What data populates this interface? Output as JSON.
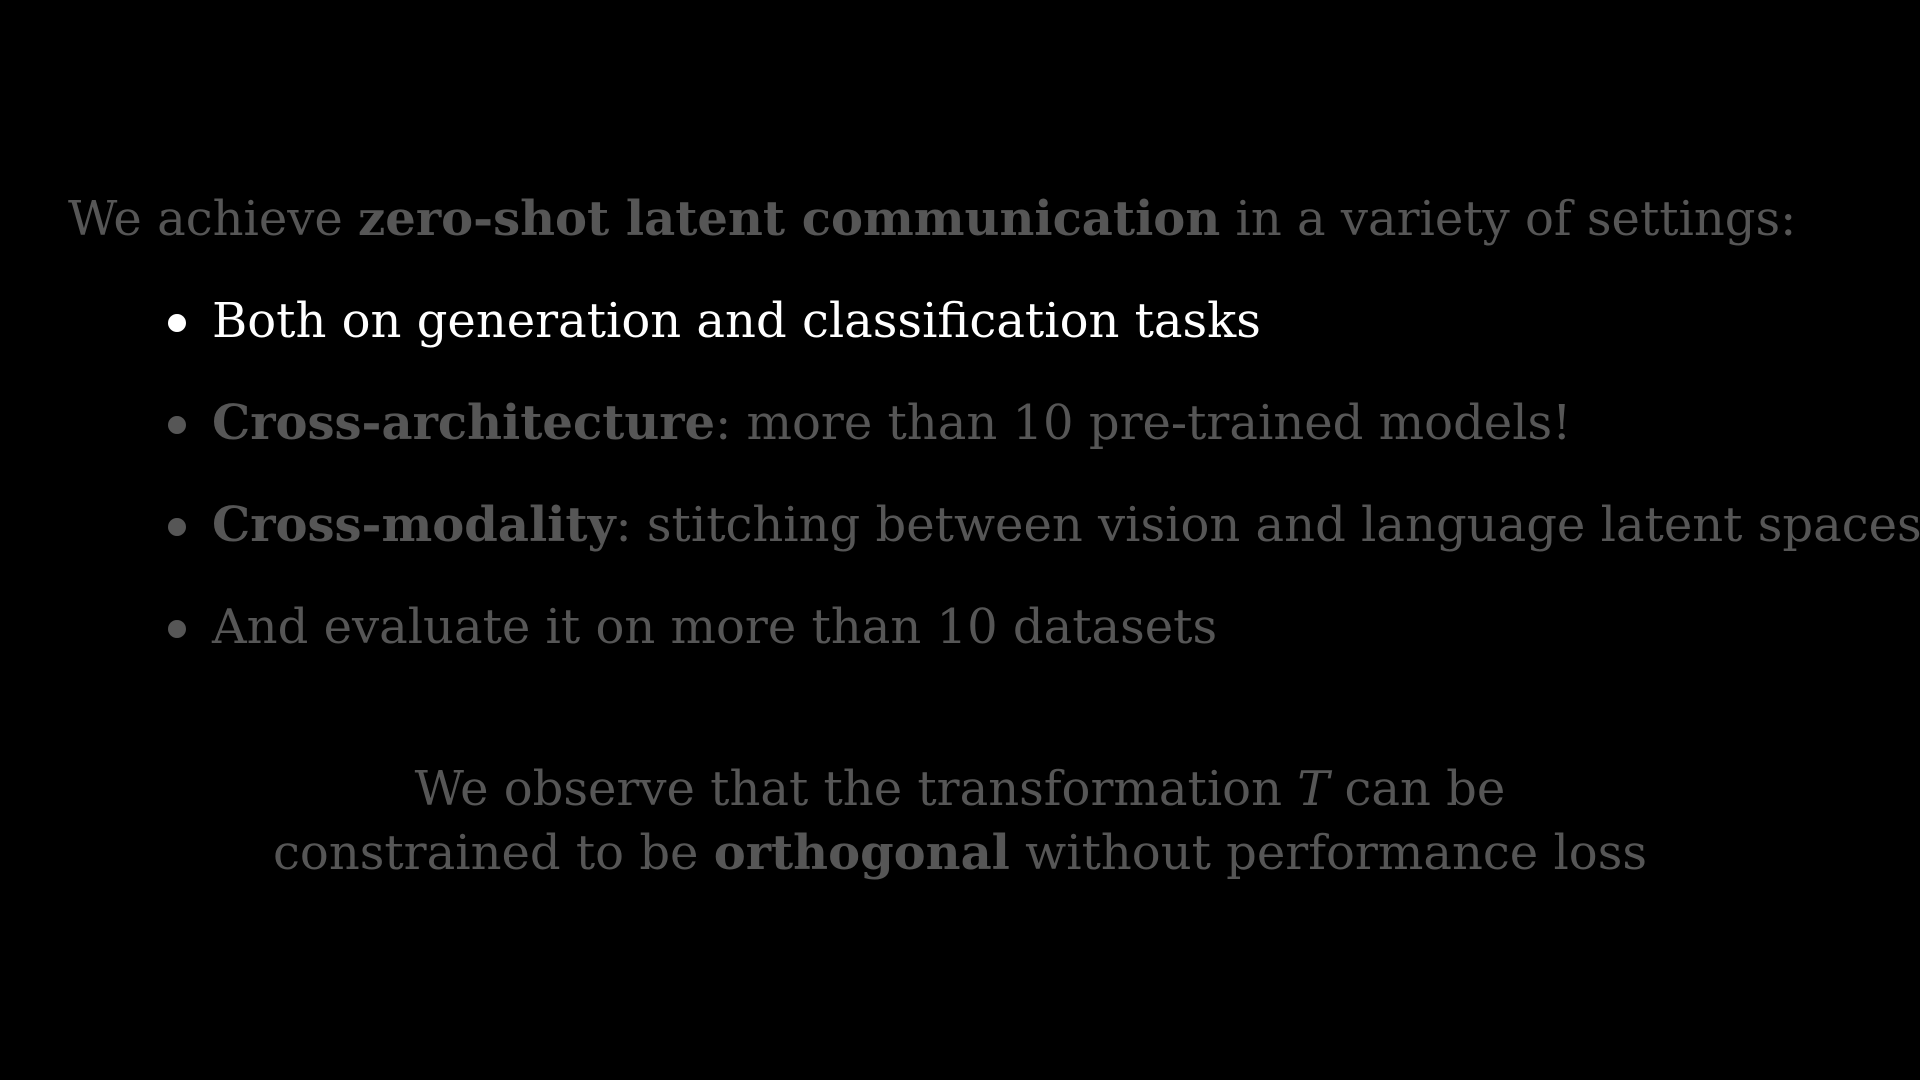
{
  "colors": {
    "background": "#000000",
    "dim": "#565656",
    "highlight": "#ffffff"
  },
  "intro": {
    "prefix": "We achieve ",
    "bold": "zero-shot latent communication",
    "suffix": " in a variety of settings:"
  },
  "bullets": [
    {
      "bold": "",
      "text": "Both on generation and classification tasks",
      "highlighted": true
    },
    {
      "bold": "Cross-architecture",
      "text": ": more than 10 pre-trained models!",
      "highlighted": false
    },
    {
      "bold": "Cross-modality",
      "text": ": stitching between vision and language latent spaces",
      "highlighted": false
    },
    {
      "bold": "",
      "text": "And evaluate it on more than 10 datasets",
      "highlighted": false
    }
  ],
  "conclusion": {
    "line1_prefix": "We observe that the transformation ",
    "line1_symbol": "T",
    "line1_suffix": " can be",
    "line2_prefix": "constrained to be ",
    "line2_bold": "orthogonal",
    "line2_suffix": " without performance loss"
  }
}
